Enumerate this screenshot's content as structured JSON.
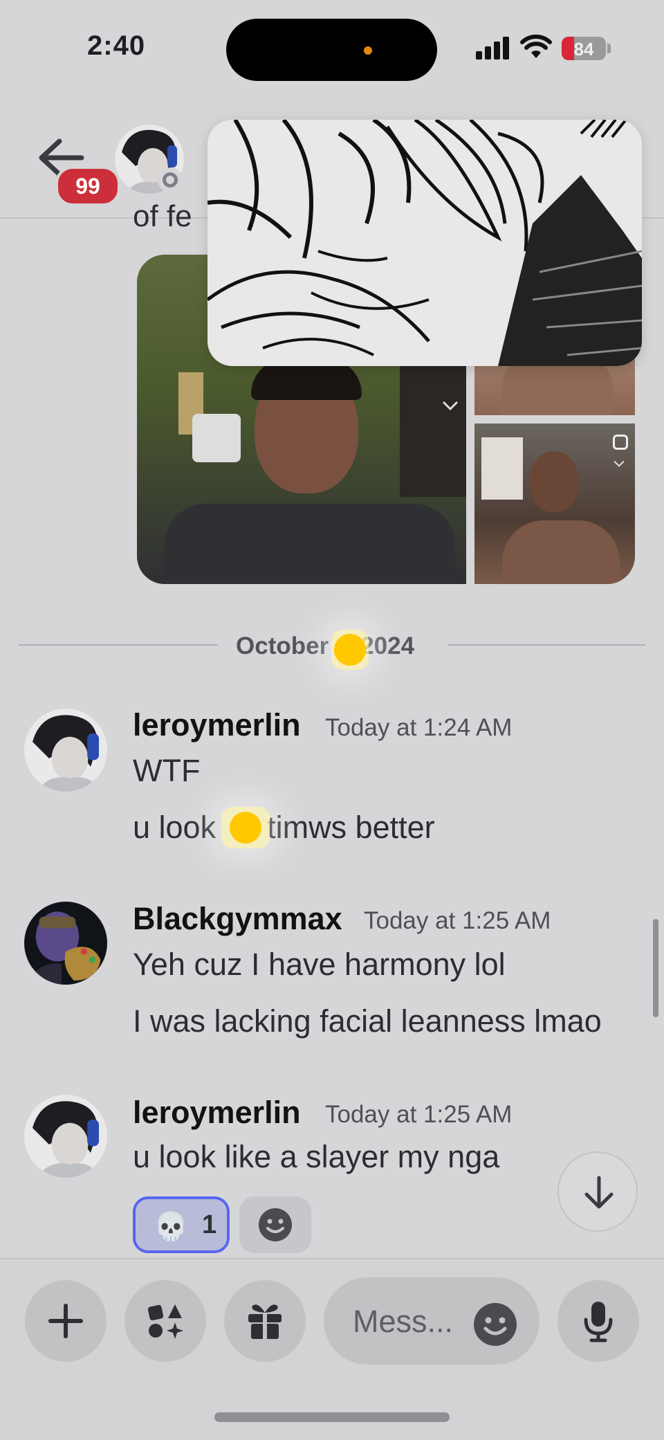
{
  "status_bar": {
    "time": "2:40",
    "battery": "84"
  },
  "header": {
    "unread_count": "99"
  },
  "feed": {
    "partial_text": "of fe",
    "date_divider": "October 2024",
    "date_divider_left": "October",
    "date_divider_right": "2024"
  },
  "messages": [
    {
      "author": "leroymerlin",
      "timestamp": "Today at 1:24 AM",
      "lines": [
        "WTF",
        "u look",
        "timws better"
      ]
    },
    {
      "author": "Blackgymmax",
      "timestamp": "Today at 1:25 AM",
      "lines": [
        "Yeh cuz I have harmony lol",
        "I was lacking facial leanness lmao"
      ]
    },
    {
      "author": "leroymerlin",
      "timestamp": "Today at 1:25 AM",
      "lines": [
        "u look like a slayer my nga"
      ]
    }
  ],
  "reaction": {
    "emoji": "💀",
    "count": "1"
  },
  "composer": {
    "placeholder": "Mess..."
  },
  "colors": {
    "accent": "#5865f2",
    "badge": "#cc2f3a",
    "touch": "#ffc800"
  },
  "icons": [
    "back-arrow-icon",
    "plus-icon",
    "apps-icon",
    "gift-icon",
    "emoji-icon",
    "mic-icon",
    "arrow-down-icon",
    "add-reaction-icon",
    "sticker-icon",
    "chevron-down-icon"
  ]
}
